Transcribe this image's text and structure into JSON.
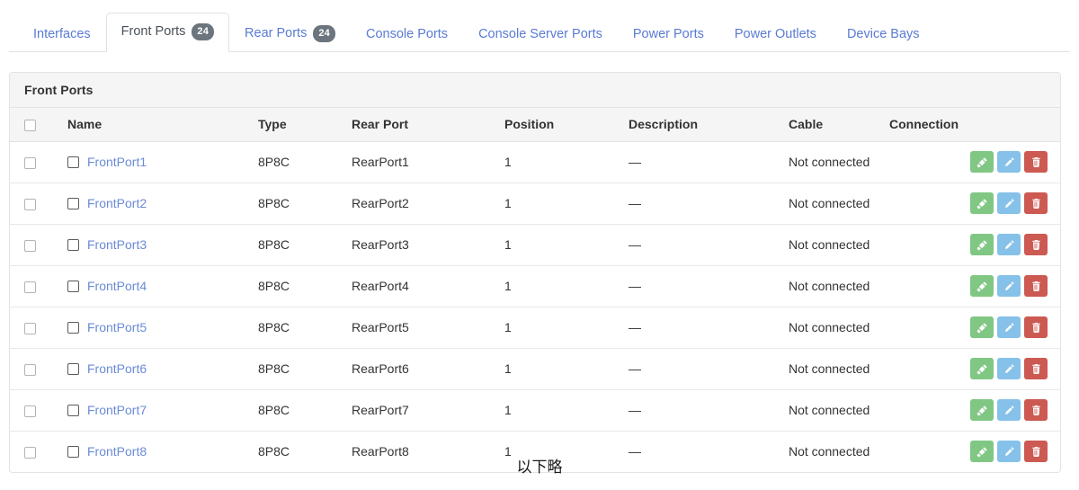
{
  "tabs": [
    {
      "label": "Interfaces",
      "badge": null,
      "active": false
    },
    {
      "label": "Front Ports",
      "badge": "24",
      "active": true
    },
    {
      "label": "Rear Ports",
      "badge": "24",
      "active": false
    },
    {
      "label": "Console Ports",
      "badge": null,
      "active": false
    },
    {
      "label": "Console Server Ports",
      "badge": null,
      "active": false
    },
    {
      "label": "Power Ports",
      "badge": null,
      "active": false
    },
    {
      "label": "Power Outlets",
      "badge": null,
      "active": false
    },
    {
      "label": "Device Bays",
      "badge": null,
      "active": false
    }
  ],
  "card": {
    "title": "Front Ports"
  },
  "table": {
    "columns": [
      "",
      "Name",
      "Type",
      "Rear Port",
      "Position",
      "Description",
      "Cable",
      "Connection",
      ""
    ],
    "rows": [
      {
        "name": "FrontPort1",
        "type": "8P8C",
        "rear_port": "RearPort1",
        "position": "1",
        "description": "—",
        "cable": "Not connected",
        "connection": ""
      },
      {
        "name": "FrontPort2",
        "type": "8P8C",
        "rear_port": "RearPort2",
        "position": "1",
        "description": "—",
        "cable": "Not connected",
        "connection": ""
      },
      {
        "name": "FrontPort3",
        "type": "8P8C",
        "rear_port": "RearPort3",
        "position": "1",
        "description": "—",
        "cable": "Not connected",
        "connection": ""
      },
      {
        "name": "FrontPort4",
        "type": "8P8C",
        "rear_port": "RearPort4",
        "position": "1",
        "description": "—",
        "cable": "Not connected",
        "connection": ""
      },
      {
        "name": "FrontPort5",
        "type": "8P8C",
        "rear_port": "RearPort5",
        "position": "1",
        "description": "—",
        "cable": "Not connected",
        "connection": ""
      },
      {
        "name": "FrontPort6",
        "type": "8P8C",
        "rear_port": "RearPort6",
        "position": "1",
        "description": "—",
        "cable": "Not connected",
        "connection": ""
      },
      {
        "name": "FrontPort7",
        "type": "8P8C",
        "rear_port": "RearPort7",
        "position": "1",
        "description": "—",
        "cable": "Not connected",
        "connection": ""
      },
      {
        "name": "FrontPort8",
        "type": "8P8C",
        "rear_port": "RearPort8",
        "position": "1",
        "description": "—",
        "cable": "Not connected",
        "connection": ""
      }
    ],
    "row_actions": [
      {
        "icon": "cable-connect-icon",
        "color": "#81c784"
      },
      {
        "icon": "pencil-edit-icon",
        "color": "#85c1e9"
      },
      {
        "icon": "trash-delete-icon",
        "color": "#cc5a52"
      }
    ]
  },
  "footer_note": "以下略",
  "colors": {
    "link": "#6a8bd6",
    "badge_bg": "#6c757d",
    "header_bg": "#f5f5f5",
    "border": "#e3e3e3",
    "muted_text": "#8a8a8a"
  }
}
